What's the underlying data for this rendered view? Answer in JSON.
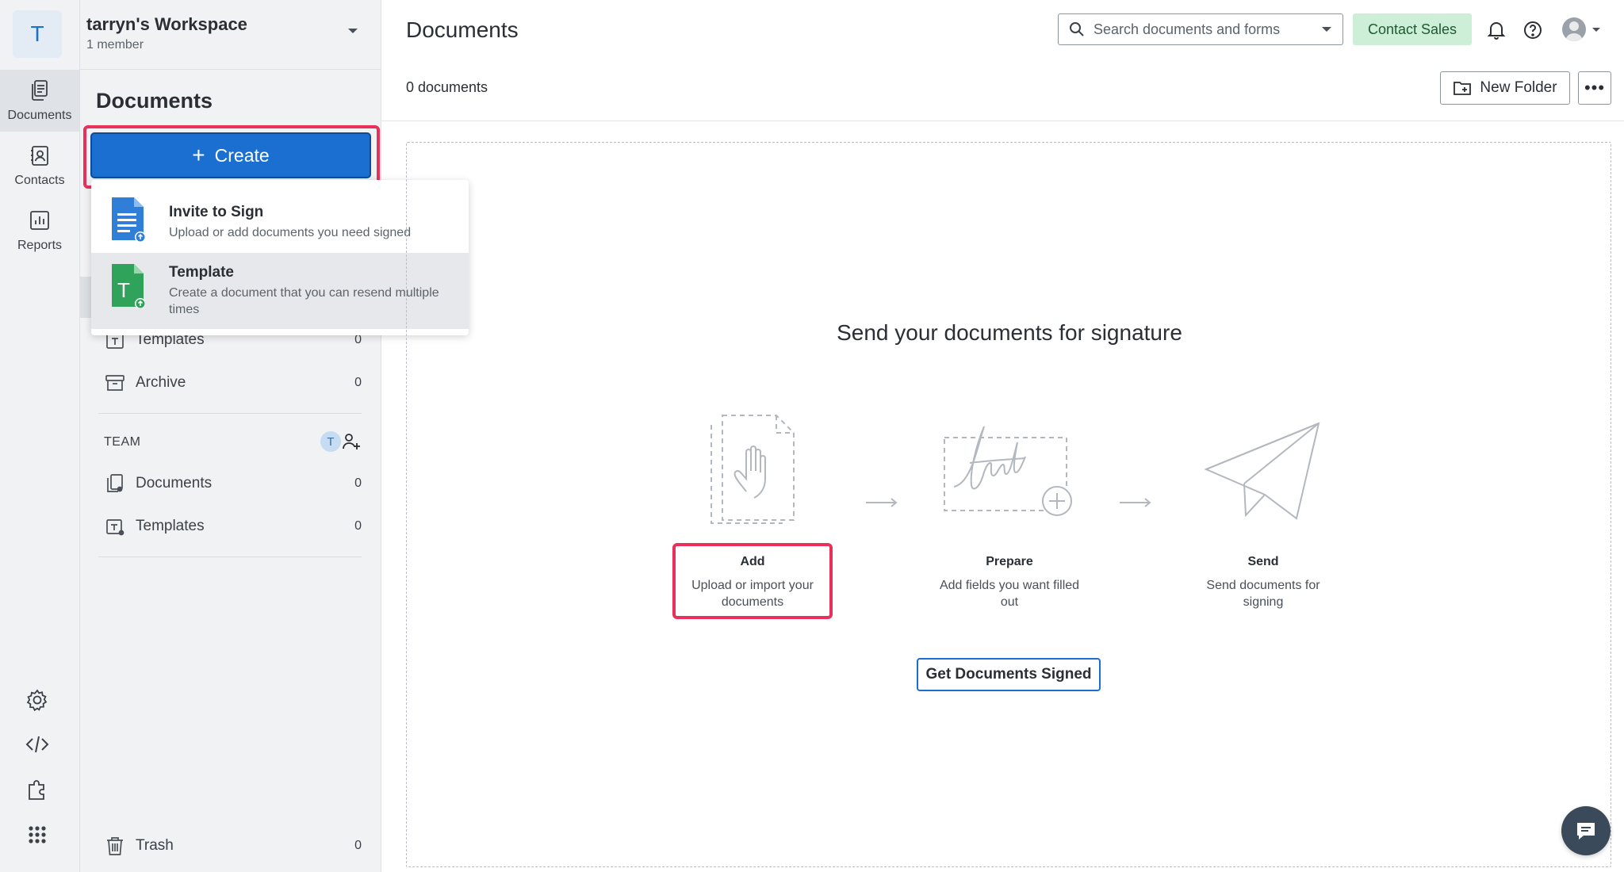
{
  "workspace": {
    "initial": "T",
    "name": "tarryn's Workspace",
    "members": "1 member"
  },
  "rail": {
    "items": [
      {
        "label": "Documents",
        "icon": "documents-icon",
        "active": true
      },
      {
        "label": "Contacts",
        "icon": "contacts-icon",
        "active": false
      },
      {
        "label": "Reports",
        "icon": "reports-icon",
        "active": false
      }
    ],
    "bottom_icons": [
      "gear-icon",
      "code-icon",
      "puzzle-icon",
      "apps-grid-icon"
    ]
  },
  "sidebar": {
    "title": "Documents",
    "create_label": "Create",
    "personal": [
      {
        "label": "Templates",
        "count": "0",
        "icon": "templates-icon"
      },
      {
        "label": "Archive",
        "count": "0",
        "icon": "archive-icon"
      }
    ],
    "team_label": "TEAM",
    "team_avatar": "T",
    "team": [
      {
        "label": "Documents",
        "count": "0",
        "icon": "team-documents-icon"
      },
      {
        "label": "Templates",
        "count": "0",
        "icon": "team-templates-icon"
      }
    ],
    "trash": {
      "label": "Trash",
      "count": "0",
      "icon": "trash-icon"
    }
  },
  "create_menu": {
    "items": [
      {
        "title": "Invite to Sign",
        "description": "Upload or add documents you need signed",
        "icon": "blue-document-upload-icon"
      },
      {
        "title": "Template",
        "description": "Create a document that you can resend multiple times",
        "icon": "green-template-icon"
      }
    ]
  },
  "header": {
    "title": "Documents",
    "search_placeholder": "Search documents and forms",
    "contact_sales": "Contact Sales"
  },
  "toolbar": {
    "doc_count": "0 documents",
    "new_folder": "New Folder",
    "more": "•••"
  },
  "empty_state": {
    "heading": "Send your documents for signature",
    "steps": [
      {
        "title": "Add",
        "description": "Upload or import your documents"
      },
      {
        "title": "Prepare",
        "description": "Add fields you want filled out"
      },
      {
        "title": "Send",
        "description": "Send documents for signing"
      }
    ],
    "cta": "Get Documents Signed"
  },
  "colors": {
    "primary": "#1a6fd1",
    "highlight_ring": "#e8305b",
    "contact_sales_bg": "#cdeed7",
    "sidebar_bg": "#f1f2f4"
  }
}
